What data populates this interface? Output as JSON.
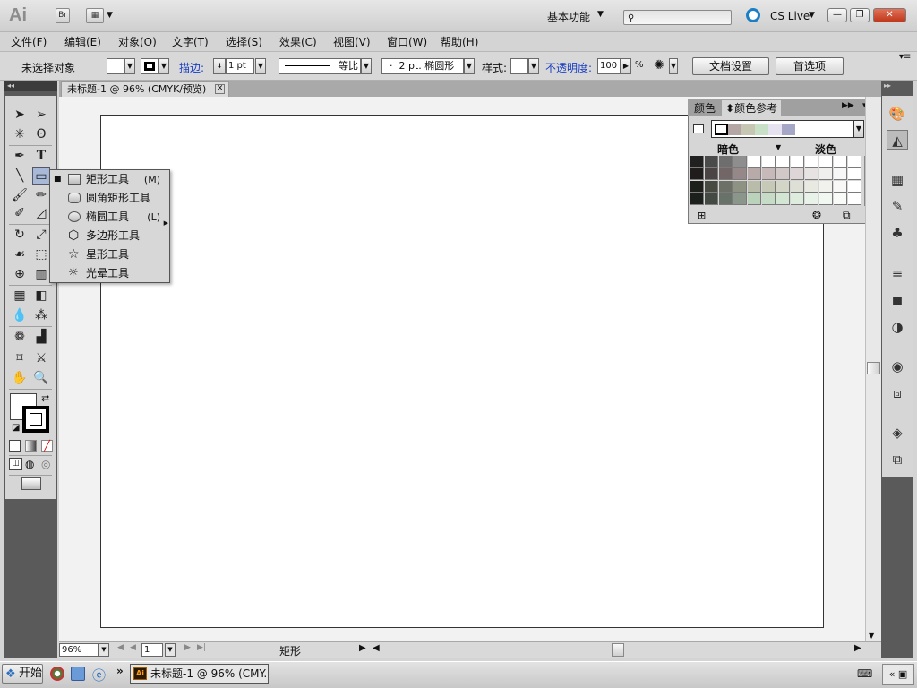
{
  "app": {
    "logo": "Ai",
    "bridge_label": "Br",
    "workspace_label": "基本功能",
    "cslive_label": "CS Live",
    "win_min": "—",
    "win_max": "❐",
    "win_close": "✕"
  },
  "menu": [
    "文件(F)",
    "编辑(E)",
    "对象(O)",
    "文字(T)",
    "选择(S)",
    "效果(C)",
    "视图(V)",
    "窗口(W)",
    "帮助(H)"
  ],
  "controlbar": {
    "selection_label": "未选择对象",
    "stroke_label": "描边:",
    "stroke_value": "1 pt",
    "stroke_profile_label": "等比",
    "brush_label": "2 pt. 椭圆形",
    "style_label": "样式:",
    "opacity_label": "不透明度:",
    "opacity_value": "100",
    "opacity_unit": "%",
    "doc_setup_button": "文档设置",
    "prefs_button": "首选项"
  },
  "document_tab": {
    "title": "未标题-1 @ 96% (CMYK/预览)",
    "close": "✕"
  },
  "flyout": {
    "items": [
      {
        "label": "矩形工具",
        "shortcut": "(M)",
        "icon": "rectangle-icon",
        "checked": true
      },
      {
        "label": "圆角矩形工具",
        "shortcut": "",
        "icon": "rounded-rectangle-icon",
        "checked": false
      },
      {
        "label": "椭圆工具",
        "shortcut": "(L)",
        "icon": "ellipse-icon",
        "checked": false
      },
      {
        "label": "多边形工具",
        "shortcut": "",
        "icon": "polygon-icon",
        "checked": false
      },
      {
        "label": "星形工具",
        "shortcut": "",
        "icon": "star-icon",
        "checked": false
      },
      {
        "label": "光晕工具",
        "shortcut": "",
        "icon": "flare-icon",
        "checked": false
      }
    ]
  },
  "guide_panel": {
    "tab_color": "颜色",
    "tab_guide": "颜色参考",
    "shades_label": "暗色",
    "tints_label": "淡色",
    "harmony_colors": [
      "#ffffff",
      "#b5a6a6",
      "#c5c7b2",
      "#c8e0c8",
      "#e6e2ef",
      "#a6a7c6"
    ],
    "grid_colors": [
      [
        "#202020",
        "#4a4a4a",
        "#6e6e6e",
        "#8e8e8e",
        "#ffffff",
        "#ffffff",
        "#ffffff",
        "#ffffff",
        "#ffffff",
        "#ffffff",
        "#ffffff",
        "#ffffff"
      ],
      [
        "#201c1c",
        "#4a4444",
        "#726666",
        "#968888",
        "#b9aaaa",
        "#c7b9b9",
        "#d3c8c8",
        "#ded6d6",
        "#e8e3e3",
        "#f1eeee",
        "#f8f7f7",
        "#ffffff"
      ],
      [
        "#1d1f1a",
        "#474a41",
        "#6c7066",
        "#8e9283",
        "#b8bca8",
        "#c6c9b6",
        "#d3d6c7",
        "#dee0d5",
        "#e8eae2",
        "#f1f2ed",
        "#f8f9f6",
        "#ffffff"
      ],
      [
        "#1c201c",
        "#434a43",
        "#697269",
        "#8a968a",
        "#bad2ba",
        "#c7dcc7",
        "#d3e5d3",
        "#deecde",
        "#e8f2e8",
        "#f1f7f1",
        "#f8fbf8",
        "#ffffff"
      ]
    ]
  },
  "status": {
    "zoom": "96%",
    "page": "1",
    "current_tool": "矩形"
  },
  "taskbar": {
    "start_label": "开始",
    "task_label": "未标题-1 @ 96% (CMY..."
  }
}
